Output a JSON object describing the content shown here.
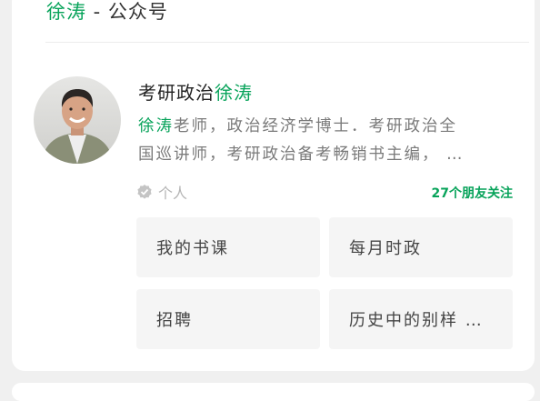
{
  "header": {
    "name_highlight": "徐涛",
    "suffix": " - 公众号"
  },
  "account": {
    "name_prefix": "考研政治",
    "name_highlight": "徐涛",
    "description_highlight": "徐涛",
    "description_line1_rest": "老师，政治经济学博士．考研政治全",
    "description_line2": "国巡讲师，考研政治备考畅销书主编， …",
    "verification_label": "个人",
    "friends_following": "27个朋友关注"
  },
  "menu": [
    {
      "label": "我的书课"
    },
    {
      "label": "每月时政"
    },
    {
      "label": "招聘"
    },
    {
      "label": "历史中的别样 …"
    }
  ],
  "icons": {
    "avatar": "person-photo-avatar",
    "verified": "verified-check-icon"
  },
  "colors": {
    "accent": "#07a35a",
    "background": "#f0f0f0",
    "card": "#ffffff",
    "button": "#f5f5f5"
  }
}
